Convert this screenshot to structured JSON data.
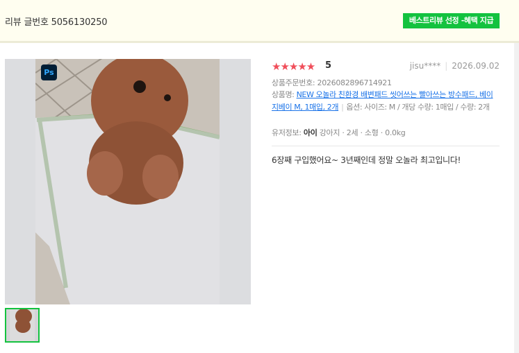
{
  "header": {
    "review_number_label": "리뷰 글번호 5056130250",
    "best_review_badge": "베스트리뷰 선정 -혜택 지급",
    "badge_color": "#13c23f"
  },
  "photo": {
    "badge_icon": "photoshop-icon",
    "badge_text": "Ps"
  },
  "review": {
    "stars": "★★★★★",
    "rating": "5",
    "star_color": "#f04e5a",
    "author": "jisu****",
    "date": "2026.09.02",
    "order_label": "상품주문번호: ",
    "order_number": "2026082896714921",
    "product_label": "상품명: ",
    "product_name": "NEW 오놀라 친환경 배변패드 씻어쓰는 빨아쓰는 방수패드, 베이지베이 M, 1매입, 2개",
    "option_text": "옵션: 사이즈: M / 개당 수량: 1매입 / 수량: 2개",
    "user_info_label": "유저정보: ",
    "user_info_pet": "아이",
    "user_info_details": " 강아지 · 2세 · 소형 · 0.0kg",
    "body": "6장째 구입했어요~ 3년째인데 정말 오놀라 최고입니다!",
    "link_color": "#1a73e8"
  }
}
